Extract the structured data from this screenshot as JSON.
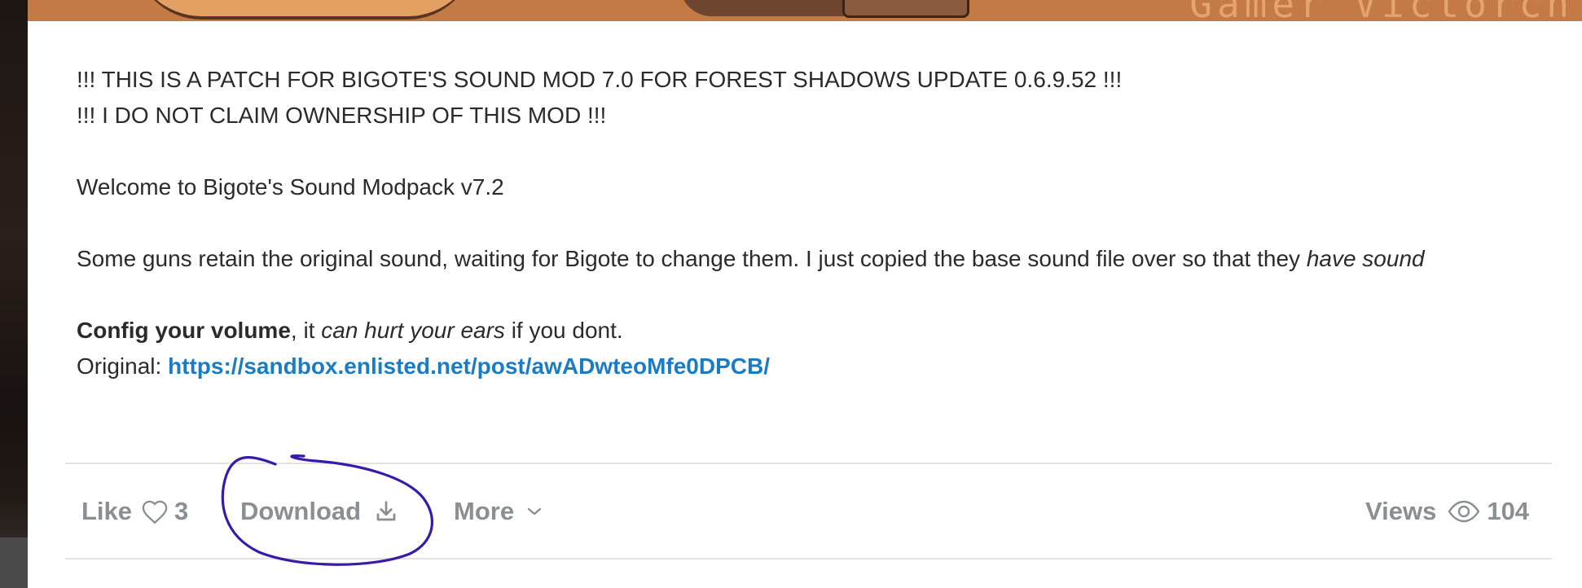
{
  "banner": {
    "text": "Gamer_Victorch"
  },
  "post": {
    "line1": "!!! THIS IS A PATCH FOR BIGOTE'S SOUND MOD 7.0 FOR FOREST SHADOWS UPDATE 0.6.9.52 !!!",
    "line2": "!!! I DO NOT CLAIM OWNERSHIP OF THIS MOD !!!",
    "welcome": "Welcome to Bigote's Sound Modpack v7.2",
    "guns_text": "Some guns retain the original sound, waiting for Bigote to change them. I just copied the base sound file over so that they ",
    "guns_italic": "have sound",
    "config_bold": "Config your volume",
    "config_mid": ", it ",
    "config_italic": "can hurt your ears",
    "config_end": " if you dont.",
    "original_label": "Original: ",
    "original_link": "https://sandbox.enlisted.net/post/awADwteoMfe0DPCB/"
  },
  "actions": {
    "like_label": "Like",
    "like_count": "3",
    "download_label": "Download",
    "more_label": "More",
    "views_label": "Views",
    "views_count": "104"
  },
  "icons": {
    "like": "heart-outline-icon",
    "download": "download-icon",
    "more": "chevron-down-icon",
    "views": "eye-icon"
  },
  "colors": {
    "link": "#1a7dc4",
    "action_text": "#8a8f94",
    "annotation": "#3a1aa8",
    "body_text": "#2b2b2b"
  }
}
